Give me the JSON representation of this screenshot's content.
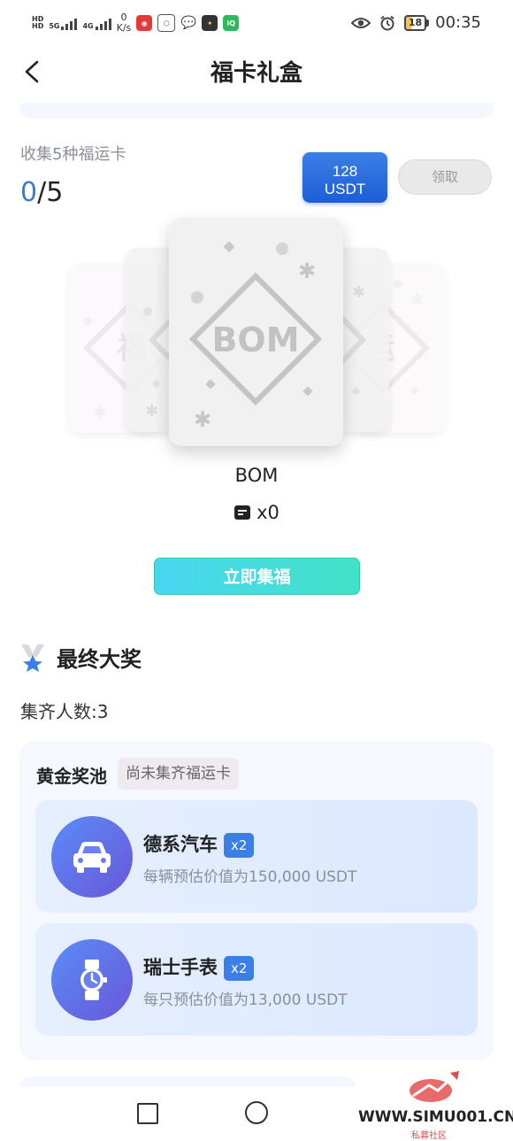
{
  "status_bar": {
    "net_speed_value": "0",
    "net_speed_unit": "K/s",
    "battery": "18",
    "time": "00:35"
  },
  "nav": {
    "title": "福卡礼盒"
  },
  "collect": {
    "label": "收集5种福运卡",
    "current": "0",
    "total": "/5",
    "reward_amount": "128",
    "reward_unit": "USDT",
    "claim_label": "领取"
  },
  "cards": {
    "current_name": "BOM",
    "count_text": "x0",
    "main_logo": "BOM",
    "side_logo_left": "福",
    "side_logo_right": "运"
  },
  "collect_button": "立即集福",
  "grand_prize": {
    "title": "最终大奖",
    "gather_count": "集齐人数:3",
    "pool": {
      "title": "黄金奖池",
      "badge": "尚未集齐福运卡",
      "items": [
        {
          "name": "德系汽车",
          "qty": "x2",
          "desc": "每辆预估价值为150,000 USDT",
          "icon": "car-icon"
        },
        {
          "name": "瑞士手表",
          "qty": "x2",
          "desc": "每只预估价值为13,000 USDT",
          "icon": "watch-icon"
        }
      ]
    }
  },
  "watermark": {
    "url": "WWW.SIMU001.CN",
    "sub": "私募社区"
  },
  "colors": {
    "accent_blue": "#3b7fe6",
    "teal": "#42e2c7"
  }
}
